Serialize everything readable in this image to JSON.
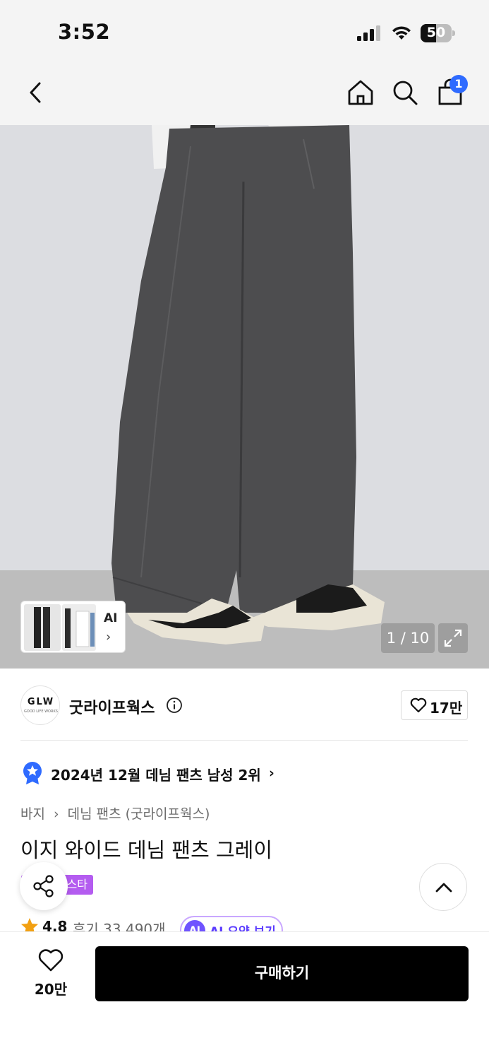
{
  "status_bar": {
    "time": "3:52",
    "battery_label": "50",
    "battery_level": 0.5
  },
  "nav": {
    "cart_count": "1",
    "icons": [
      "back-icon",
      "home-icon",
      "search-icon",
      "cart-icon"
    ]
  },
  "gallery": {
    "ai_label": "AI",
    "ai_chevron": "›",
    "counter": "1 / 10"
  },
  "brand": {
    "logo_text": "GLW",
    "logo_subtext": "GOOD LIFE WORKS",
    "name": "굿라이프웍스",
    "likes": "17만"
  },
  "ranking": {
    "text": "2024년 12월 데님 팬츠 남성 2위",
    "chevron": "›"
  },
  "breadcrumb": {
    "items": [
      "바지",
      "›",
      "데님 팬츠 (굿라이프웍스)"
    ]
  },
  "product": {
    "title": "이지 와이드 데님 팬츠 그레이",
    "tag": "스타"
  },
  "rating": {
    "score": "4.8",
    "reviews": "후기 33,490개",
    "ai_badge": "AI",
    "ai_summary": "AI 요약 보기"
  },
  "bottom": {
    "wish_count": "20만",
    "buy_label": "구매하기"
  },
  "colors": {
    "accent_blue": "#2f6bff",
    "tag_purple": "#b45cf0",
    "ai_purple": "#6f53ff",
    "buy_button": "#000000"
  }
}
